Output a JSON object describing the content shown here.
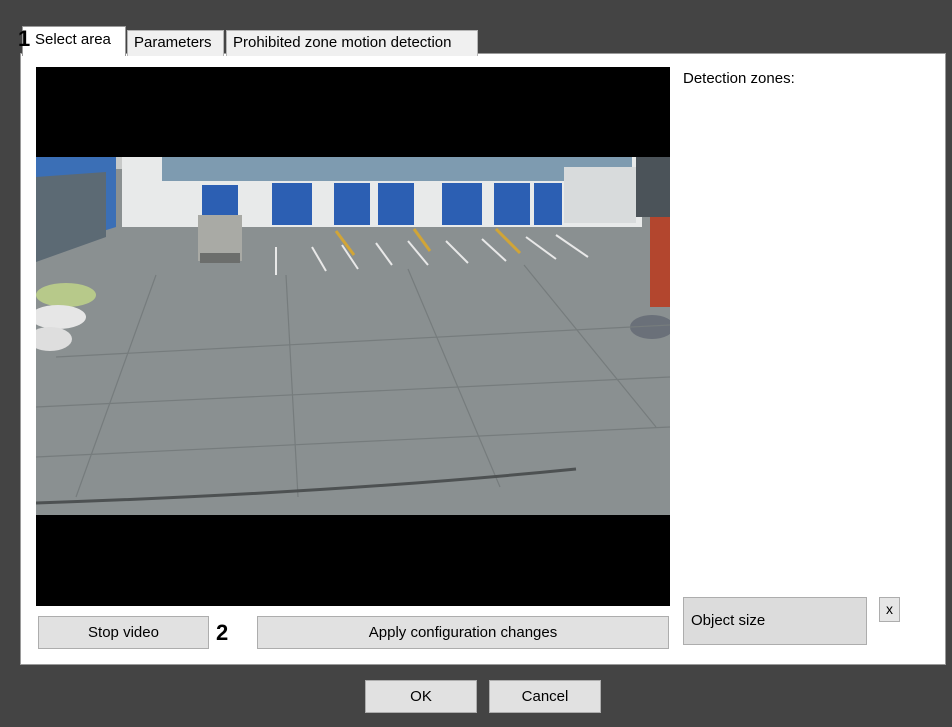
{
  "tabs": [
    {
      "label": "Select area",
      "active": true
    },
    {
      "label": "Parameters",
      "active": false
    },
    {
      "label": "Prohibited zone motion detection",
      "active": false
    }
  ],
  "callouts": {
    "one": "1",
    "two": "2"
  },
  "zones": {
    "label": "Detection zones:"
  },
  "buttons": {
    "stop_video": "Stop video",
    "apply": "Apply configuration changes",
    "object_size": "Object size",
    "remove": "x",
    "ok": "OK",
    "cancel": "Cancel"
  },
  "colors": {
    "frame_bg": "#444444",
    "panel_bg": "#ffffff",
    "button_bg": "#e1e1e1",
    "video_bg": "#000000"
  },
  "icons": {
    "video": "camera-feed-image"
  }
}
